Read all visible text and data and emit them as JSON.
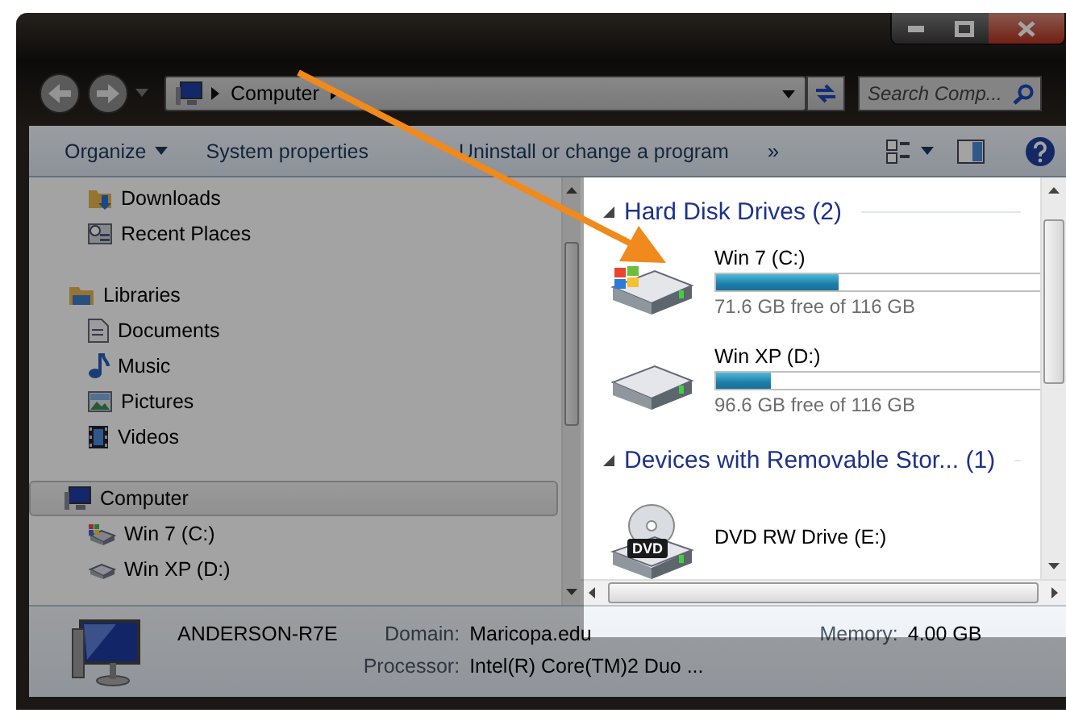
{
  "address_bar": {
    "path": [
      {
        "label": "Computer"
      }
    ]
  },
  "search": {
    "placeholder": "Search Comp..."
  },
  "toolbar": {
    "items": [
      {
        "label": "Organize",
        "kind": "menu"
      },
      {
        "label": "System properties",
        "kind": "button"
      },
      {
        "label": "Uninstall or change a program",
        "kind": "button"
      }
    ],
    "overflow": "»"
  },
  "navigation_pane": {
    "items": [
      {
        "children": [
          {
            "label": "Downloads",
            "kind": "downloads",
            "selected": false
          },
          {
            "label": "Recent Places",
            "kind": "recent",
            "selected": false
          }
        ]
      },
      {
        "label": "Libraries",
        "kind": "library",
        "selected": false,
        "children": [
          {
            "label": "Documents",
            "kind": "document",
            "selected": false
          },
          {
            "label": "Music",
            "kind": "music",
            "selected": false
          },
          {
            "label": "Pictures",
            "kind": "pictures",
            "selected": false
          },
          {
            "label": "Videos",
            "kind": "videos",
            "selected": false
          }
        ]
      },
      {
        "label": "Computer",
        "kind": "computer",
        "selected": true,
        "children": [
          {
            "label": "Win 7 (C:)",
            "kind": "system-drive",
            "selected": false
          },
          {
            "label": "Win XP (D:)",
            "kind": "drive",
            "selected": false
          }
        ]
      }
    ]
  },
  "content": {
    "groups": [
      {
        "title": "Hard Disk Drives (2)",
        "expanded": true,
        "items": [
          {
            "name": "Win 7 (C:)",
            "kind": "system-drive",
            "level": 0.38,
            "reading": "71.6 GB free of 116 GB"
          },
          {
            "name": "Win XP (D:)",
            "kind": "drive",
            "level": 0.17,
            "reading": "96.6 GB free of 116 GB"
          }
        ]
      },
      {
        "title": "Devices with Removable Stor... (1)",
        "expanded": true,
        "items": [
          {
            "name": "DVD RW Drive (E:)",
            "kind": "dvd",
            "badge": "DVD"
          }
        ]
      }
    ]
  },
  "details_pane": {
    "computer_name": "ANDERSON-R7E",
    "fields": [
      {
        "label": "Domain:",
        "value": "Maricopa.edu"
      },
      {
        "label": "Memory:",
        "value": "4.00 GB"
      },
      {
        "label": "Processor:",
        "value": "Intel(R) Core(TM)2 Duo ..."
      }
    ]
  }
}
